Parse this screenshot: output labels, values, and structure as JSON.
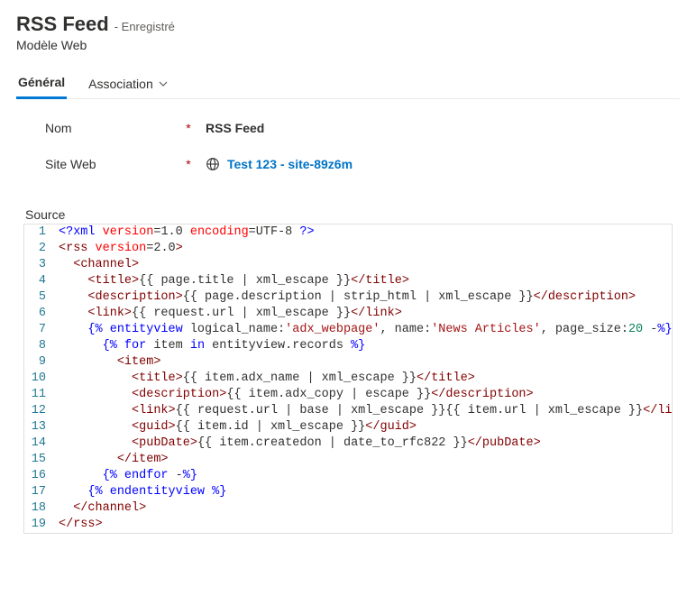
{
  "header": {
    "title": "RSS Feed",
    "saved_badge": "- Enregistré",
    "subtitle": "Modèle Web"
  },
  "tabs": {
    "general": "Général",
    "association": "Association"
  },
  "fields": {
    "name_label": "Nom",
    "name_value": "RSS Feed",
    "site_label": "Site Web",
    "site_value": "Test 123 - site-89z6m"
  },
  "source": {
    "label": "Source",
    "lines": [
      {
        "n": "1",
        "html": "<span class='c-ang'>&lt;?</span><span class='c-pi'>xml</span> <span class='c-attr'>version</span>=1.0 <span class='c-attr'>encoding</span>=UTF-8 <span class='c-ang'>?&gt;</span>"
      },
      {
        "n": "2",
        "html": "<span class='c-br'>&lt;</span><span class='c-tag'>rss</span> <span class='c-attr'>version</span>=2.0<span class='c-br'>&gt;</span>"
      },
      {
        "n": "3",
        "html": "  <span class='c-br'>&lt;</span><span class='c-tag'>channel</span><span class='c-br'>&gt;</span>"
      },
      {
        "n": "4",
        "html": "    <span class='c-br'>&lt;</span><span class='c-tag'>title</span><span class='c-br'>&gt;</span>{{ page.title | xml_escape }}<span class='c-br'>&lt;/</span><span class='c-tag'>title</span><span class='c-br'>&gt;</span>"
      },
      {
        "n": "5",
        "html": "    <span class='c-br'>&lt;</span><span class='c-tag'>description</span><span class='c-br'>&gt;</span>{{ page.description | strip_html | xml_escape }}<span class='c-br'>&lt;/</span><span class='c-tag'>description</span><span class='c-br'>&gt;</span>"
      },
      {
        "n": "6",
        "html": "    <span class='c-br'>&lt;</span><span class='c-tag'>link</span><span class='c-br'>&gt;</span>{{ request.url | xml_escape }}<span class='c-br'>&lt;/</span><span class='c-tag'>link</span><span class='c-br'>&gt;</span>"
      },
      {
        "n": "7",
        "html": "    <span class='c-liq'>{%</span> <span class='c-liq'>entityview</span> logical_name:<span class='c-str'>'adx_webpage'</span>, name:<span class='c-str'>'News Articles'</span>, page_size:<span class='c-num'>20</span> -<span class='c-liq'>%}</span>"
      },
      {
        "n": "8",
        "html": "      <span class='c-liq'>{%</span> <span class='c-liq'>for</span> item <span class='c-liq'>in</span> entityview.records <span class='c-liq'>%}</span>"
      },
      {
        "n": "9",
        "html": "        <span class='c-br'>&lt;</span><span class='c-tag'>item</span><span class='c-br'>&gt;</span>"
      },
      {
        "n": "10",
        "html": "          <span class='c-br'>&lt;</span><span class='c-tag'>title</span><span class='c-br'>&gt;</span>{{ item.adx_name | xml_escape }}<span class='c-br'>&lt;/</span><span class='c-tag'>title</span><span class='c-br'>&gt;</span>"
      },
      {
        "n": "11",
        "html": "          <span class='c-br'>&lt;</span><span class='c-tag'>description</span><span class='c-br'>&gt;</span>{{ item.adx_copy | escape }}<span class='c-br'>&lt;/</span><span class='c-tag'>description</span><span class='c-br'>&gt;</span>"
      },
      {
        "n": "12",
        "html": "          <span class='c-br'>&lt;</span><span class='c-tag'>link</span><span class='c-br'>&gt;</span>{{ request.url | base | xml_escape }}{{ item.url | xml_escape }}<span class='c-br'>&lt;/</span><span class='c-tag'>link</span><span class='c-br'>&gt;</span>"
      },
      {
        "n": "13",
        "html": "          <span class='c-br'>&lt;</span><span class='c-tag'>guid</span><span class='c-br'>&gt;</span>{{ item.id | xml_escape }}<span class='c-br'>&lt;/</span><span class='c-tag'>guid</span><span class='c-br'>&gt;</span>"
      },
      {
        "n": "14",
        "html": "          <span class='c-br'>&lt;</span><span class='c-tag'>pubDate</span><span class='c-br'>&gt;</span>{{ item.createdon | date_to_rfc822 }}<span class='c-br'>&lt;/</span><span class='c-tag'>pubDate</span><span class='c-br'>&gt;</span>"
      },
      {
        "n": "15",
        "html": "        <span class='c-br'>&lt;/</span><span class='c-tag'>item</span><span class='c-br'>&gt;</span>"
      },
      {
        "n": "16",
        "html": "      <span class='c-liq'>{%</span> <span class='c-liq'>endfor</span> -<span class='c-liq'>%}</span>"
      },
      {
        "n": "17",
        "html": "    <span class='c-liq'>{%</span> <span class='c-liq'>endentityview</span> <span class='c-liq'>%}</span>"
      },
      {
        "n": "18",
        "html": "  <span class='c-br'>&lt;/</span><span class='c-tag'>channel</span><span class='c-br'>&gt;</span>"
      },
      {
        "n": "19",
        "html": "<span class='c-br'>&lt;/</span><span class='c-tag'>rss</span><span class='c-br'>&gt;</span>"
      }
    ]
  }
}
